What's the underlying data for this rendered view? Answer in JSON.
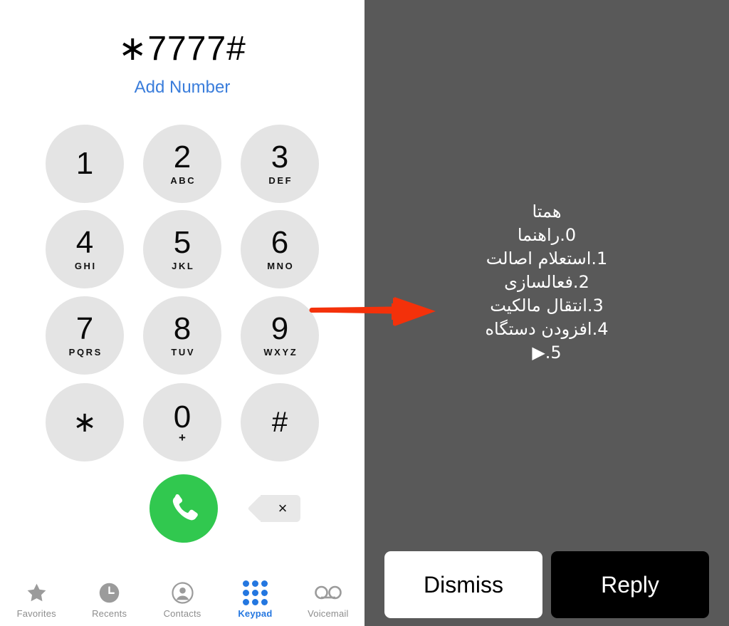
{
  "phone": {
    "dialed_number": "∗7777#",
    "add_number_label": "Add Number",
    "add_number_color": "#3a7ddb",
    "keypad": [
      {
        "digit": "1",
        "letters": ""
      },
      {
        "digit": "2",
        "letters": "ABC"
      },
      {
        "digit": "3",
        "letters": "DEF"
      },
      {
        "digit": "4",
        "letters": "GHI"
      },
      {
        "digit": "5",
        "letters": "JKL"
      },
      {
        "digit": "6",
        "letters": "MNO"
      },
      {
        "digit": "7",
        "letters": "PQRS"
      },
      {
        "digit": "8",
        "letters": "TUV"
      },
      {
        "digit": "9",
        "letters": "WXYZ"
      },
      {
        "digit": "∗",
        "letters": ""
      },
      {
        "digit": "0",
        "letters": "+"
      },
      {
        "digit": "#",
        "letters": ""
      }
    ],
    "call_button": {
      "icon": "phone-handset-icon",
      "color": "#31c84f"
    },
    "delete_button": {
      "icon": "backspace-delete-icon",
      "glyph": "×"
    },
    "tabs": [
      {
        "label": "Favorites",
        "icon": "star-icon",
        "active": false
      },
      {
        "label": "Recents",
        "icon": "clock-icon",
        "active": false
      },
      {
        "label": "Contacts",
        "icon": "person-circle-icon",
        "active": false
      },
      {
        "label": "Keypad",
        "icon": "keypad-dots-icon",
        "active": true
      },
      {
        "label": "Voicemail",
        "icon": "voicemail-icon",
        "active": false
      }
    ],
    "tab_inactive_color": "#8d8d8d",
    "tab_active_color": "#2477e0"
  },
  "ussd": {
    "background_color": "#595959",
    "message_lines": [
      "همتا",
      "0.راهنما",
      "1.استعلام اصالت",
      "2.فعالسازی",
      "3.انتقال مالکیت",
      "4.افزودن دستگاه",
      "5.▶"
    ],
    "dismiss_label": "Dismiss",
    "reply_label": "Reply"
  },
  "annotation": {
    "arrow_color": "#f4310a",
    "direction": "right"
  }
}
